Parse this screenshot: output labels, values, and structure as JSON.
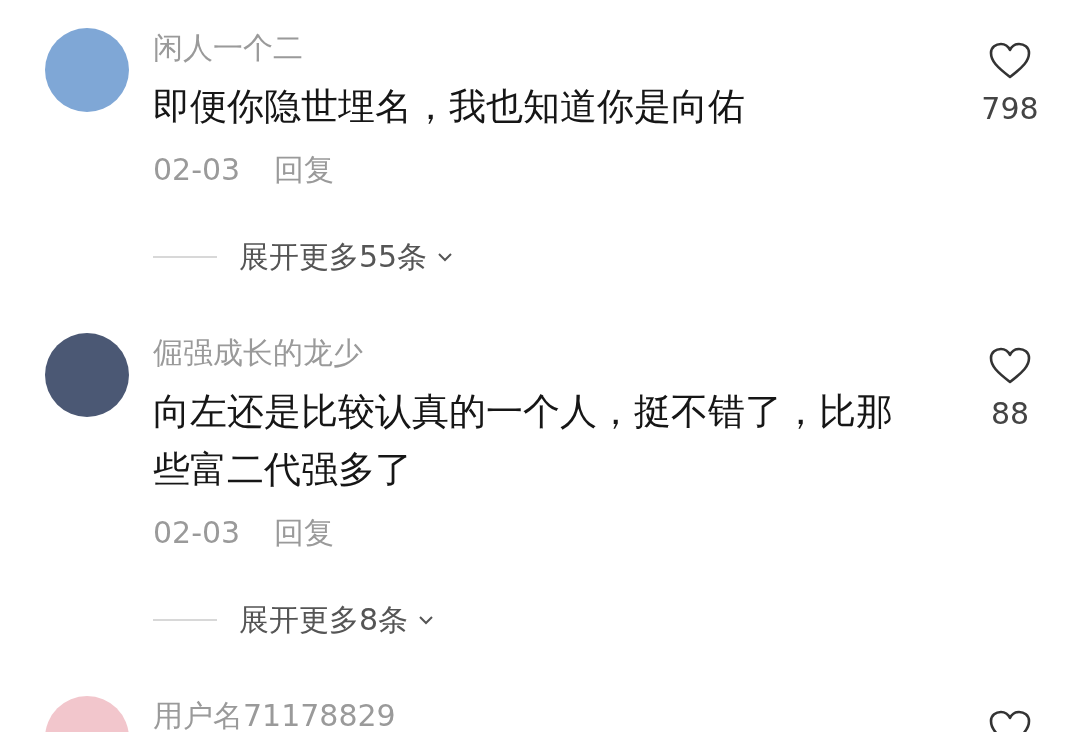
{
  "comments": [
    {
      "avatar": {
        "color": "#7fa7d6"
      },
      "name": "闲人一个二",
      "text": "即便你隐世埋名，我也知道你是向佑",
      "likes": "798",
      "date": "02-03",
      "reply": "回复",
      "expand": "展开更多55条"
    },
    {
      "avatar": {
        "color": "#4b5874"
      },
      "name": "倔强成长的龙少",
      "text": "向左还是比较认真的一个人，挺不错了，比那些富二代强多了",
      "likes": "88",
      "date": "02-03",
      "reply": "回复",
      "expand": "展开更多8条"
    },
    {
      "avatar": {
        "color": "#f2c6cc"
      },
      "name": "用户名71178829"
    }
  ]
}
